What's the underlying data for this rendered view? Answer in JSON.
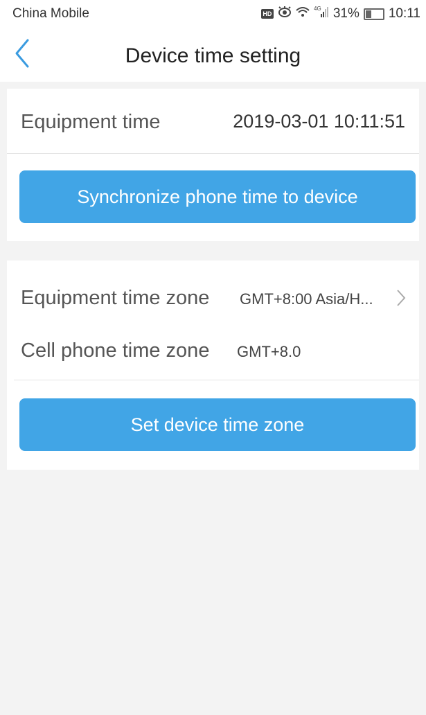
{
  "status_bar": {
    "carrier": "China Mobile",
    "network": "4G",
    "battery": "31%",
    "time": "10:11"
  },
  "header": {
    "title": "Device time setting"
  },
  "equipment_time": {
    "label": "Equipment time",
    "value": "2019-03-01 10:11:51"
  },
  "sync_button": {
    "label": "Synchronize phone time to device"
  },
  "timezone": {
    "equipment_label": "Equipment time zone",
    "equipment_value": "GMT+8:00 Asia/H...",
    "phone_label": "Cell phone time zone",
    "phone_value": "GMT+8.0"
  },
  "set_timezone_button": {
    "label": "Set device time zone"
  },
  "colors": {
    "accent": "#41a5e6",
    "background": "#f3f3f3"
  }
}
